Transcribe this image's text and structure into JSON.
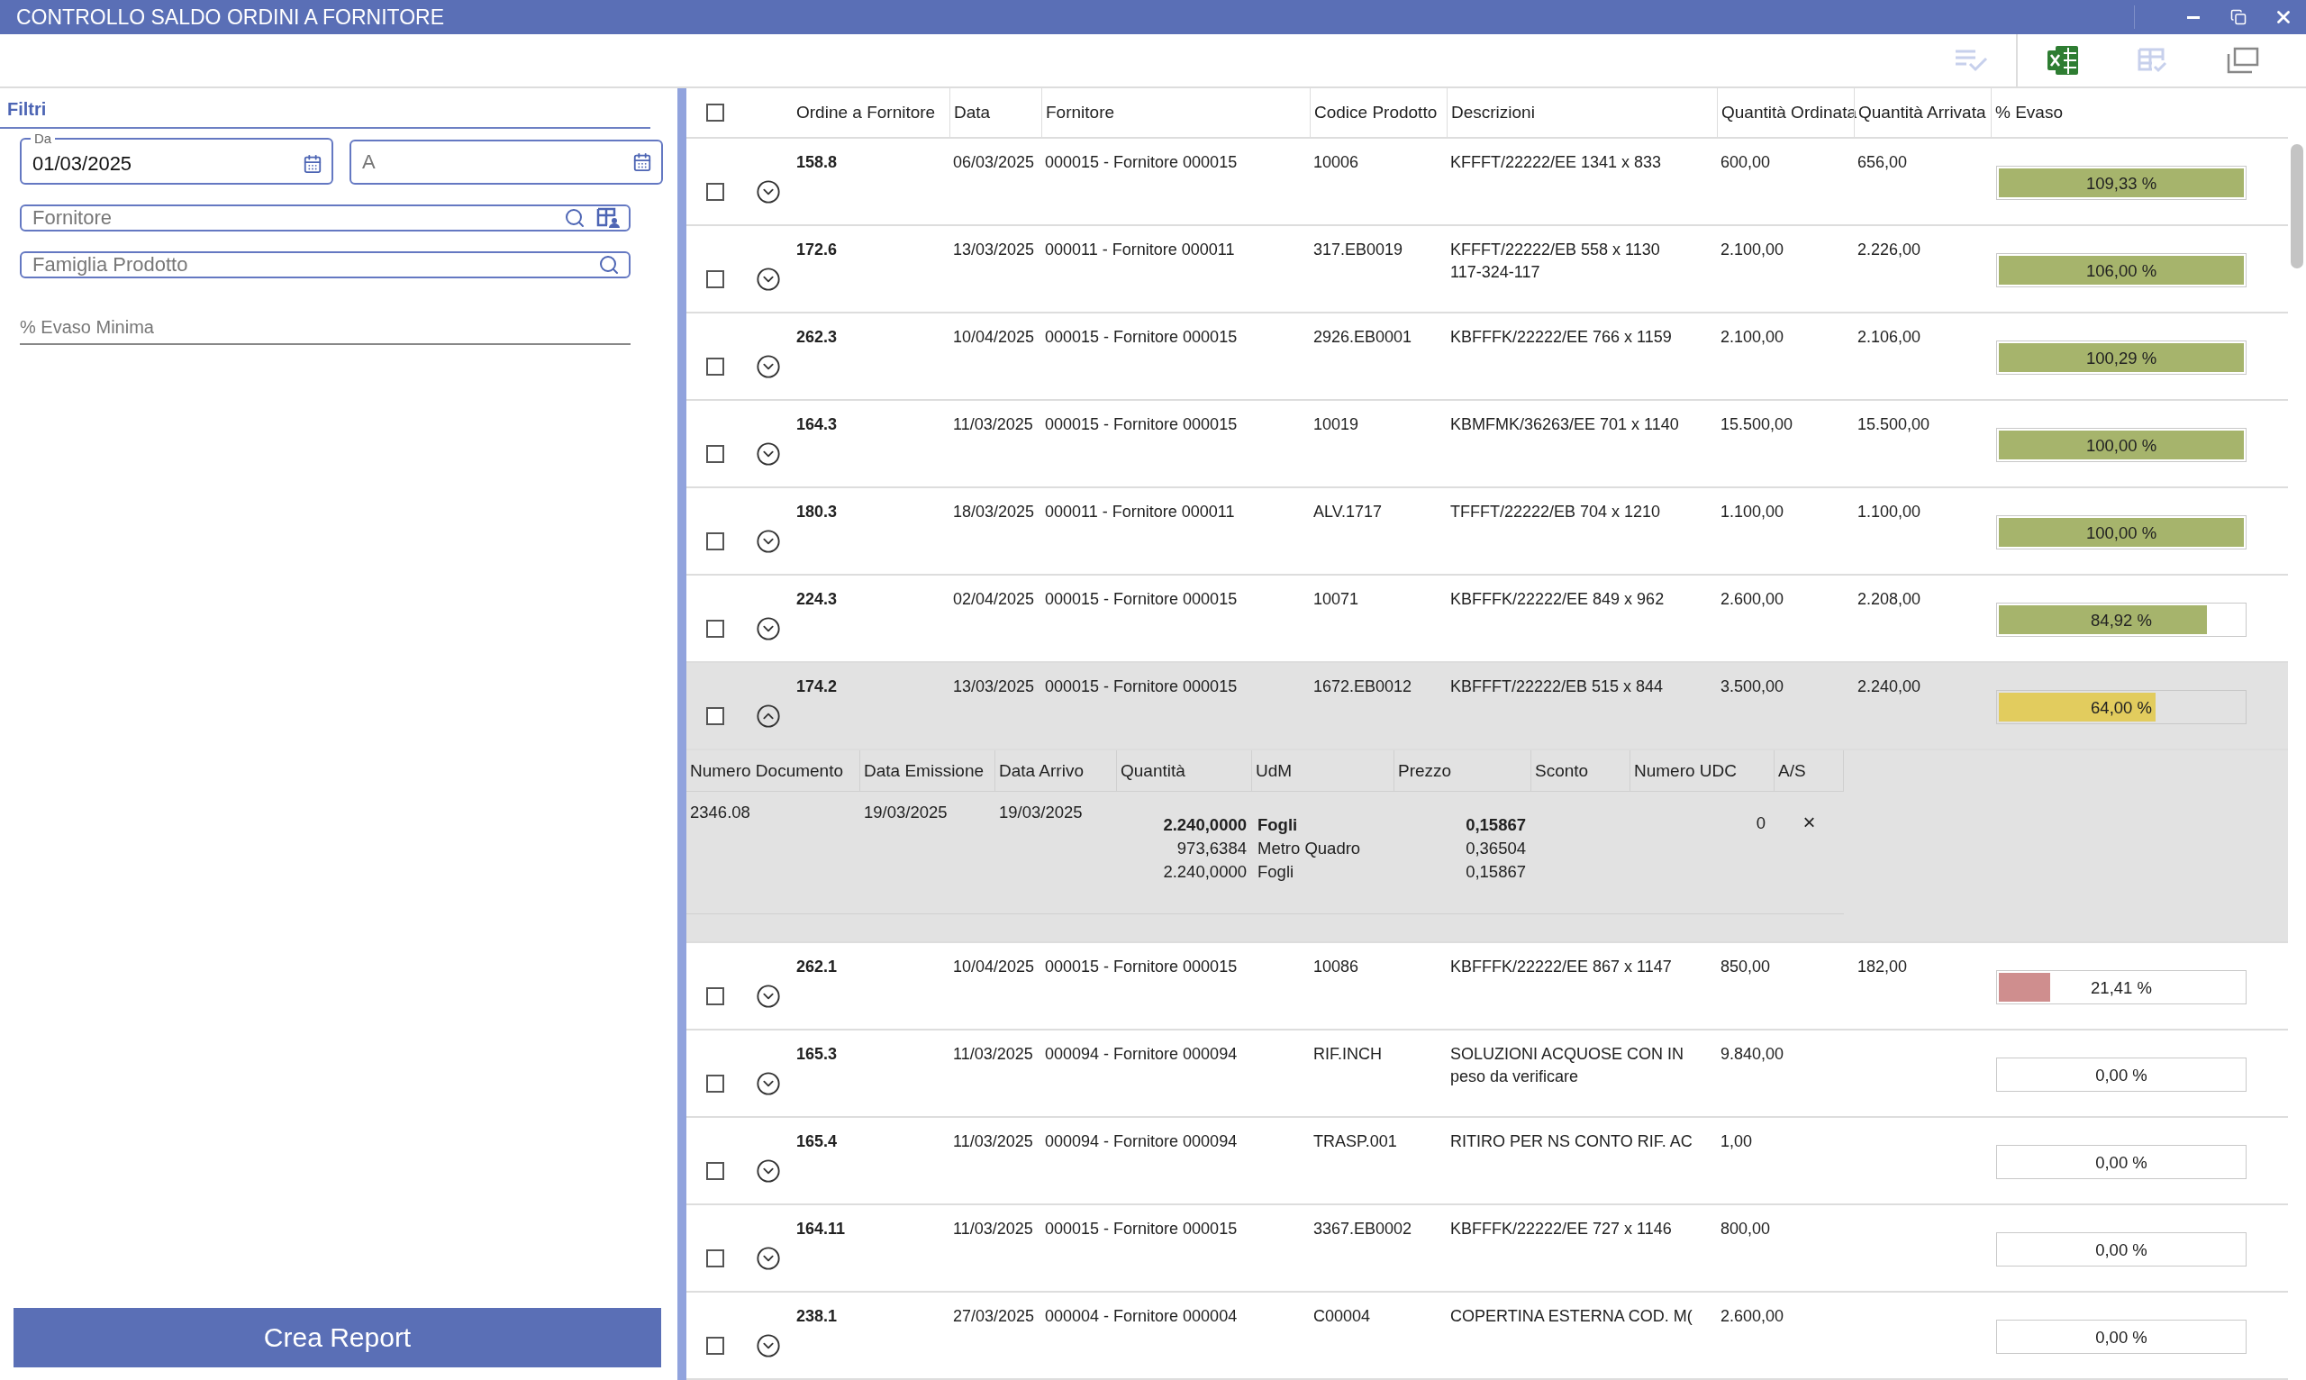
{
  "window": {
    "title": "CONTROLLO SALDO ORDINI A FORNITORE"
  },
  "filters": {
    "title": "Filtri",
    "from": {
      "label": "Da",
      "value": "01/03/2025"
    },
    "to": {
      "placeholder": "A"
    },
    "supplier": {
      "placeholder": "Fornitore"
    },
    "family": {
      "placeholder": "Famiglia Prodotto"
    },
    "min_percent": {
      "placeholder": "% Evaso Minima"
    },
    "button": "Crea Report"
  },
  "table": {
    "header_checkbox": {
      "checked": false
    },
    "columns": [
      "Ordine a Fornitore",
      "Data",
      "Fornitore",
      "Codice Prodotto",
      "Descrizioni",
      "Quantità Ordinata",
      "Quantità Arrivata",
      "% Evaso"
    ],
    "rows": [
      {
        "order": "158.8",
        "date": "06/03/2025",
        "supplier": "000015 - Fornitore 000015",
        "code": "10006",
        "description": [
          "KFFFT/22222/EE 1341 x 833"
        ],
        "qty_ordered": "600,00",
        "qty_arrived": "656,00",
        "percent": "109,33 %",
        "level": 1,
        "color": "#a6b46c",
        "checked": false,
        "expanded": false
      },
      {
        "order": "172.6",
        "date": "13/03/2025",
        "supplier": "000011 - Fornitore 000011",
        "code": "317.EB0019",
        "description": [
          "KFFFT/22222/EB 558 x 1130",
          "117-324-117"
        ],
        "qty_ordered": "2.100,00",
        "qty_arrived": "2.226,00",
        "percent": "106,00 %",
        "level": 1,
        "color": "#a6b46c",
        "checked": false,
        "expanded": false
      },
      {
        "order": "262.3",
        "date": "10/04/2025",
        "supplier": "000015 - Fornitore 000015",
        "code": "2926.EB0001",
        "description": [
          "KBFFFK/22222/EE 766 x 1159"
        ],
        "qty_ordered": "2.100,00",
        "qty_arrived": "2.106,00",
        "percent": "100,29 %",
        "level": 1,
        "color": "#a6b46c",
        "checked": false,
        "expanded": false
      },
      {
        "order": "164.3",
        "date": "11/03/2025",
        "supplier": "000015 - Fornitore 000015",
        "code": "10019",
        "description": [
          "KBMFMK/36263/EE 701 x 1140"
        ],
        "qty_ordered": "15.500,00",
        "qty_arrived": "15.500,00",
        "percent": "100,00 %",
        "level": 1,
        "color": "#a6b46c",
        "checked": false,
        "expanded": false
      },
      {
        "order": "180.3",
        "date": "18/03/2025",
        "supplier": "000011 - Fornitore 000011",
        "code": "ALV.1717",
        "description": [
          "TFFFT/22222/EB 704 x 1210"
        ],
        "qty_ordered": "1.100,00",
        "qty_arrived": "1.100,00",
        "percent": "100,00 %",
        "level": 1,
        "color": "#a6b46c",
        "checked": false,
        "expanded": false
      },
      {
        "order": "224.3",
        "date": "02/04/2025",
        "supplier": "000015 - Fornitore 000015",
        "code": "10071",
        "description": [
          "KBFFFK/22222/EE 849 x 962"
        ],
        "qty_ordered": "2.600,00",
        "qty_arrived": "2.208,00",
        "percent": "84,92 %",
        "level": 0.85,
        "color": "#a6b46c",
        "checked": false,
        "expanded": false
      },
      {
        "order": "174.2",
        "date": "13/03/2025",
        "supplier": "000015 - Fornitore 000015",
        "code": "1672.EB0012",
        "description": [
          "KBFFFT/22222/EB 515 x 844"
        ],
        "qty_ordered": "3.500,00",
        "qty_arrived": "2.240,00",
        "percent": "64,00 %",
        "level": 0.64,
        "color": "#e2cc5e",
        "checked": false,
        "expanded": true,
        "detail": {
          "columns": [
            "Numero Documento",
            "Data Emissione",
            "Data Arrivo",
            "Quantità",
            "UdM",
            "Prezzo",
            "Sconto",
            "Numero UDC",
            "A/S"
          ],
          "rows": [
            {
              "document": "2346.08",
              "issued": "19/03/2025",
              "arrival": "19/03/2025",
              "lines": [
                {
                  "quantity": "2.240,0000",
                  "unit": "Fogli",
                  "price": "0,15867",
                  "bold": true
                },
                {
                  "quantity": "973,6384",
                  "unit": "Metro Quadro",
                  "price": "0,36504",
                  "bold": false
                },
                {
                  "quantity": "2.240,0000",
                  "unit": "Fogli",
                  "price": "0,15867",
                  "bold": false
                }
              ],
              "udc": "0",
              "as": "×"
            }
          ]
        }
      },
      {
        "order": "262.1",
        "date": "10/04/2025",
        "supplier": "000015 - Fornitore 000015",
        "code": "10086",
        "description": [
          "KBFFFK/22222/EE 867 x 1147"
        ],
        "qty_ordered": "850,00",
        "qty_arrived": "182,00",
        "percent": "21,41 %",
        "level": 0.21,
        "color": "#cf8e8e",
        "checked": false,
        "expanded": false
      },
      {
        "order": "165.3",
        "date": "11/03/2025",
        "supplier": "000094 - Fornitore 000094",
        "code": "RIF.INCH",
        "description": [
          "SOLUZIONI ACQUOSE CON IN",
          "peso da verificare"
        ],
        "qty_ordered": "9.840,00",
        "percent": "0,00 %",
        "checked": false,
        "expanded": false
      },
      {
        "order": "165.4",
        "date": "11/03/2025",
        "supplier": "000094 - Fornitore 000094",
        "code": "TRASP.001",
        "description": [
          "RITIRO PER NS CONTO RIF. AC"
        ],
        "qty_ordered": "1,00",
        "percent": "0,00 %",
        "checked": false,
        "expanded": false
      },
      {
        "order": "164.11",
        "date": "11/03/2025",
        "supplier": "000015 - Fornitore 000015",
        "code": "3367.EB0002",
        "description": [
          "KBFFFK/22222/EE 727 x 1146"
        ],
        "qty_ordered": "800,00",
        "percent": "0,00 %",
        "checked": false,
        "expanded": false
      },
      {
        "order": "238.1",
        "date": "27/03/2025",
        "supplier": "000004 - Fornitore 000004",
        "code": "C00004",
        "description": [
          "COPERTINA ESTERNA COD. M("
        ],
        "qty_ordered": "2.600,00",
        "percent": "0,00 %",
        "checked": false,
        "expanded": false
      }
    ]
  }
}
